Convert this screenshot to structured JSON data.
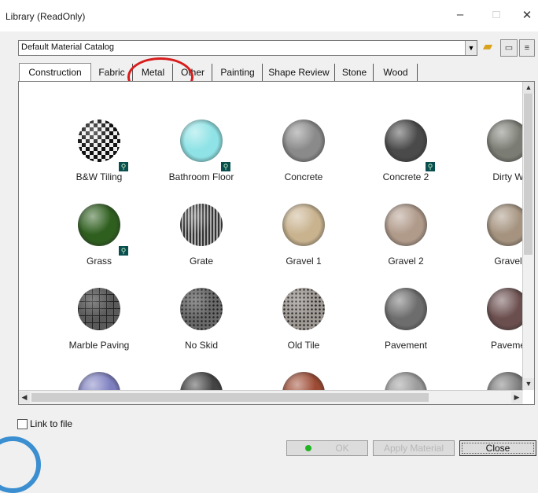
{
  "window": {
    "title": "Library (ReadOnly)",
    "minimize_label": "–",
    "maximize_label": "□",
    "close_label": "✕"
  },
  "catalog": {
    "selected": "Default Material Catalog"
  },
  "tabs": [
    {
      "label": "Construction",
      "active": true
    },
    {
      "label": "Fabric",
      "active": false
    },
    {
      "label": "Metal",
      "active": false
    },
    {
      "label": "Other",
      "active": false
    },
    {
      "label": "Painting",
      "active": false
    },
    {
      "label": "Shape Review",
      "active": false
    },
    {
      "label": "Stone",
      "active": false
    },
    {
      "label": "Wood",
      "active": false
    }
  ],
  "materials": [
    {
      "label": "B&W Tiling",
      "color": "#777777",
      "pattern": "checker",
      "badge": true
    },
    {
      "label": "Bathroom Floor",
      "color": "#8fe3e6",
      "pattern": "plain",
      "badge": true
    },
    {
      "label": "Concrete",
      "color": "#8a8a8a",
      "pattern": "plain",
      "badge": false
    },
    {
      "label": "Concrete 2",
      "color": "#4a4a4a",
      "pattern": "plain",
      "badge": true
    },
    {
      "label": "Dirty W",
      "color": "#7b7d74",
      "pattern": "plain",
      "badge": false
    },
    {
      "label": "Grass",
      "color": "#2f5f1f",
      "pattern": "plain",
      "badge": true
    },
    {
      "label": "Grate",
      "color": "#5c5c5c",
      "pattern": "stripes",
      "badge": false
    },
    {
      "label": "Gravel 1",
      "color": "#c9b38f",
      "pattern": "plain",
      "badge": false
    },
    {
      "label": "Gravel 2",
      "color": "#b09a8a",
      "pattern": "plain",
      "badge": false
    },
    {
      "label": "Gravel",
      "color": "#a5937f",
      "pattern": "plain",
      "badge": false
    },
    {
      "label": "Marble Paving",
      "color": "#5a5a5a",
      "pattern": "grid",
      "badge": false
    },
    {
      "label": "No Skid",
      "color": "#6a6a6a",
      "pattern": "dots",
      "badge": false
    },
    {
      "label": "Old Tile",
      "color": "#a09a95",
      "pattern": "dots",
      "badge": false
    },
    {
      "label": "Pavement",
      "color": "#6d6d6d",
      "pattern": "plain",
      "badge": false
    },
    {
      "label": "Paveme",
      "color": "#6b4e4e",
      "pattern": "plain",
      "badge": false
    },
    {
      "label": "",
      "color": "#7d7fc0",
      "pattern": "plain",
      "badge": false
    },
    {
      "label": "",
      "color": "#444444",
      "pattern": "plain",
      "badge": false
    },
    {
      "label": "",
      "color": "#9c4a33",
      "pattern": "plain",
      "badge": false
    },
    {
      "label": "",
      "color": "#9a9a9a",
      "pattern": "plain",
      "badge": false
    },
    {
      "label": "",
      "color": "#7a7a7a",
      "pattern": "plain",
      "badge": false
    }
  ],
  "link_to_file": {
    "label": "Link to file",
    "checked": false
  },
  "buttons": {
    "ok": "OK",
    "apply": "Apply Material",
    "close": "Close"
  },
  "colors": {
    "annotation": "#d81c1c"
  }
}
